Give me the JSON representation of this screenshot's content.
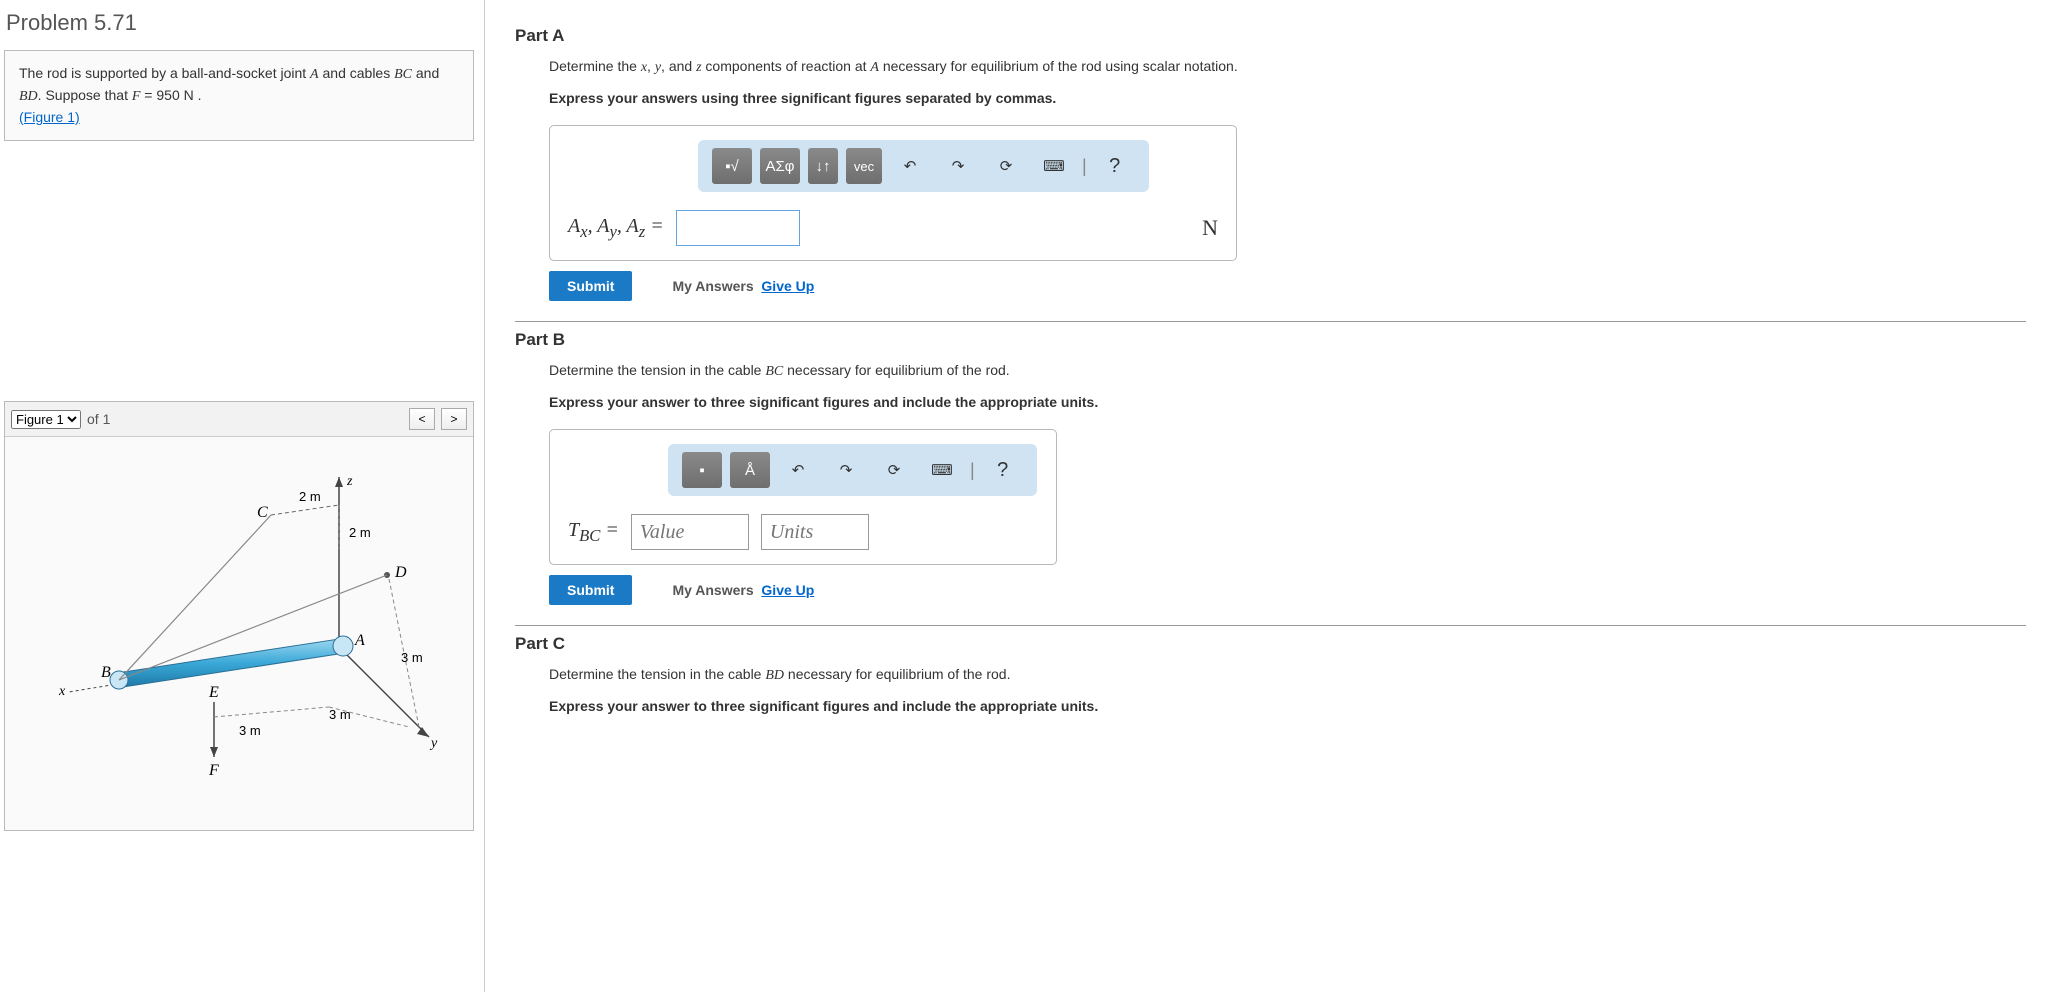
{
  "problem_title": "Problem 5.71",
  "problem_text_a": "The rod is supported by a ball-and-socket joint ",
  "problem_text_b": " and cables ",
  "problem_text_c": " and ",
  "problem_text_d": ". Suppose that ",
  "problem_text_e": " = 950  N .",
  "sym_A": "A",
  "sym_BC": "BC",
  "sym_BD": "BD",
  "sym_F": "F",
  "figure_link": "(Figure 1)",
  "figure": {
    "select": "Figure 1",
    "of": "of 1",
    "labels": {
      "z": "z",
      "x": "x",
      "y": "y",
      "A": "A",
      "B": "B",
      "C": "C",
      "D": "D",
      "E": "E",
      "F": "F",
      "d2a": "2 m",
      "d2b": "2 m",
      "d3a": "3 m",
      "d3b": "3 m",
      "d3c": "3 m"
    }
  },
  "partA": {
    "title": "Part A",
    "q1": "Determine the ",
    "q2": ", and ",
    "q3": " components of reaction at ",
    "q4": " necessary for equilibrium of the rod using scalar notation.",
    "sx": "x",
    "sy": "y",
    "sz": "z",
    "instr": "Express your answers using three significant figures separated by commas.",
    "label_html": "A_x, A_y, A_z =",
    "unit": "N",
    "tools": {
      "template": "□",
      "sqrt": "√",
      "greek": "ΑΣφ",
      "updown": "↓↑",
      "vec": "vec",
      "undo": "↶",
      "redo": "↷",
      "reset": "⟳",
      "kb": "⌨",
      "help": "?"
    }
  },
  "partB": {
    "title": "Part B",
    "q1": "Determine the tension in the cable ",
    "q2": " necessary for equilibrium of the rod.",
    "instr": "Express your answer to three significant figures and include the appropriate units.",
    "label": "T_BC =",
    "val_ph": "Value",
    "unit_ph": "Units",
    "tools": {
      "t1": "□",
      "t2": "Å",
      "undo": "↶",
      "redo": "↷",
      "reset": "⟳",
      "kb": "⌨",
      "help": "?"
    }
  },
  "partC": {
    "title": "Part C",
    "q1": "Determine the tension in the cable ",
    "q2": " necessary for equilibrium of the rod.",
    "instr": "Express your answer to three significant figures and include the appropriate units."
  },
  "buttons": {
    "submit": "Submit",
    "my_answers": "My Answers",
    "give_up": "Give Up"
  }
}
